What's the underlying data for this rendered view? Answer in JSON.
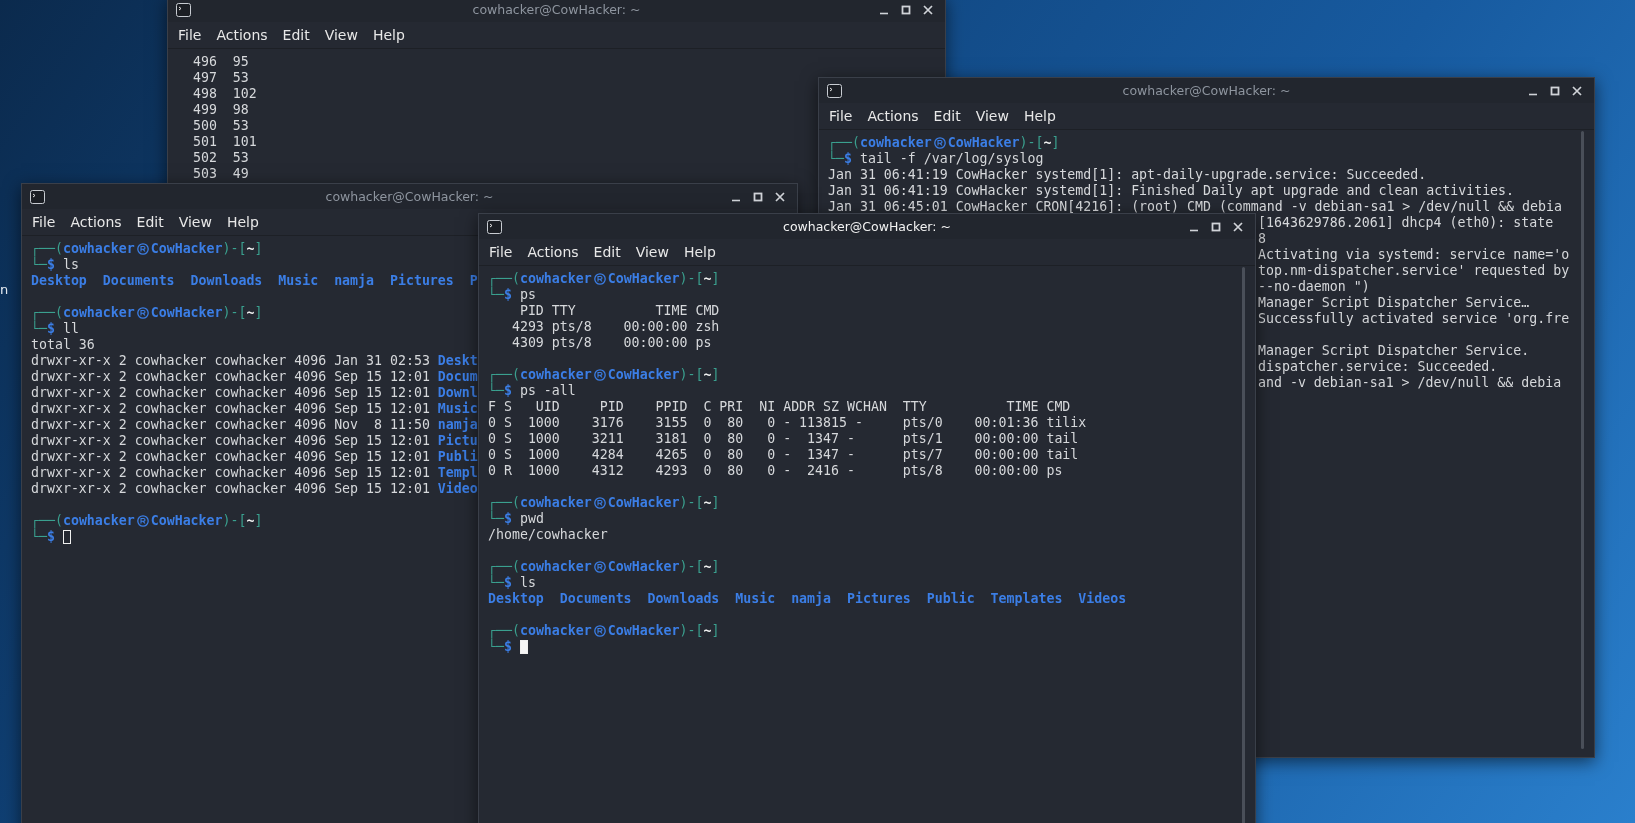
{
  "desktop": {
    "icon_label": "n"
  },
  "windows": [
    {
      "title": "cowhacker@CowHacker: ~",
      "active": false,
      "menu": [
        "File",
        "Actions",
        "Edit",
        "View",
        "Help"
      ],
      "history": [
        {
          "number": "496",
          "value": "95"
        },
        {
          "number": "497",
          "value": "53"
        },
        {
          "number": "498",
          "value": "102"
        },
        {
          "number": "499",
          "value": "98"
        },
        {
          "number": "500",
          "value": "53"
        },
        {
          "number": "501",
          "value": "101"
        },
        {
          "number": "502",
          "value": "53"
        },
        {
          "number": "503",
          "value": "49"
        }
      ]
    },
    {
      "title": "cowhacker@CowHacker: ~",
      "active": false,
      "menu": [
        "File",
        "Actions",
        "Edit",
        "View",
        "Help"
      ],
      "blocks": [
        {
          "prompt_top": [
            "┌──(",
            "cowhacker",
            "CowHacker",
            ")-[",
            "~",
            "]"
          ],
          "prompt_bottom": [
            "└─",
            "$"
          ],
          "command": "tail -f /var/log/syslog",
          "output": [
            {
              "kind": "text",
              "text": "Jan 31 06:41:19 CowHacker systemd[1]: apt-daily-upgrade.service: Succeeded."
            },
            {
              "kind": "text",
              "text": "Jan 31 06:41:19 CowHacker systemd[1]: Finished Daily apt upgrade and clean activities."
            },
            {
              "kind": "text",
              "text": "Jan 31 06:45:01 CowHacker CRON[4216]: (root) CMD (command -v debian-sa1 > /dev/null && debia"
            }
          ]
        }
      ],
      "log_fragments": [
        [
          "[1643629786.2061] dhcp4 (eth0): state",
          "8",
          "Activating via systemd: service name='o",
          "top.nm-dispatcher.service' requested by",
          "--no-daemon \")",
          "Manager Script Dispatcher Service…",
          "Successfully activated service 'org.fre"
        ],
        [
          "Manager Script Dispatcher Service.",
          "dispatcher.service: Succeeded.",
          "and -v debian-sa1 > /dev/null && debia"
        ]
      ]
    },
    {
      "title": "cowhacker@CowHacker: ~",
      "active": false,
      "menu": [
        "File",
        "Actions",
        "Edit",
        "View",
        "Help"
      ],
      "blocks": [
        {
          "prompt_top": [
            "┌──(",
            "cowhacker",
            "CowHacker",
            ")-[",
            "~",
            "]"
          ],
          "prompt_bottom": [
            "└─",
            "$"
          ],
          "command": "ls",
          "output": [
            {
              "kind": "dirs",
              "names": [
                "Desktop",
                "Documents",
                "Downloads",
                "Music",
                "namja",
                "Pictures",
                "P"
              ]
            }
          ]
        },
        {
          "prompt_top": [
            "┌──(",
            "cowhacker",
            "CowHacker",
            ")-[",
            "~",
            "]"
          ],
          "prompt_bottom": [
            "└─",
            "$"
          ],
          "command": "ll",
          "output": [
            {
              "kind": "text",
              "text": "total 36"
            },
            {
              "kind": "entry",
              "text": "drwxr-xr-x 2 cowhacker cowhacker 4096 Jan 31 02:53",
              "name": "Deskt"
            },
            {
              "kind": "entry",
              "text": "drwxr-xr-x 2 cowhacker cowhacker 4096 Sep 15 12:01",
              "name": "Docum"
            },
            {
              "kind": "entry",
              "text": "drwxr-xr-x 2 cowhacker cowhacker 4096 Sep 15 12:01",
              "name": "Downl"
            },
            {
              "kind": "entry",
              "text": "drwxr-xr-x 2 cowhacker cowhacker 4096 Sep 15 12:01",
              "name": "Music"
            },
            {
              "kind": "entry",
              "text": "drwxr-xr-x 2 cowhacker cowhacker 4096 Nov  8 11:50",
              "name": "namja"
            },
            {
              "kind": "entry",
              "text": "drwxr-xr-x 2 cowhacker cowhacker 4096 Sep 15 12:01",
              "name": "Pictu"
            },
            {
              "kind": "entry",
              "text": "drwxr-xr-x 2 cowhacker cowhacker 4096 Sep 15 12:01",
              "name": "Publi"
            },
            {
              "kind": "entry",
              "text": "drwxr-xr-x 2 cowhacker cowhacker 4096 Sep 15 12:01",
              "name": "Templ"
            },
            {
              "kind": "entry",
              "text": "drwxr-xr-x 2 cowhacker cowhacker 4096 Sep 15 12:01",
              "name": "Video"
            }
          ]
        },
        {
          "prompt_top": [
            "┌──(",
            "cowhacker",
            "CowHacker",
            ")-[",
            "~",
            "]"
          ],
          "prompt_bottom": [
            "└─",
            "$"
          ],
          "cursor": true
        }
      ]
    },
    {
      "title": "cowhacker@CowHacker: ~",
      "active": true,
      "menu": [
        "File",
        "Actions",
        "Edit",
        "View",
        "Help"
      ],
      "blocks": [
        {
          "prompt_top": [
            "┌──(",
            "cowhacker",
            "CowHacker",
            ")-[",
            "~",
            "]"
          ],
          "prompt_bottom": [
            "└─",
            "$"
          ],
          "command": "ps",
          "output": [
            {
              "kind": "text",
              "text": "    PID TTY          TIME CMD"
            },
            {
              "kind": "text",
              "text": "   4293 pts/8    00:00:00 zsh"
            },
            {
              "kind": "text",
              "text": "   4309 pts/8    00:00:00 ps"
            }
          ]
        },
        {
          "prompt_top": [
            "┌──(",
            "cowhacker",
            "CowHacker",
            ")-[",
            "~",
            "]"
          ],
          "prompt_bottom": [
            "└─",
            "$"
          ],
          "command": "ps -all",
          "output": [
            {
              "kind": "text",
              "text": "F S   UID     PID    PPID  C PRI  NI ADDR SZ WCHAN  TTY          TIME CMD"
            },
            {
              "kind": "text",
              "text": "0 S  1000    3176    3155  0  80   0 - 113815 -     pts/0    00:01:36 tilix"
            },
            {
              "kind": "text",
              "text": "0 S  1000    3211    3181  0  80   0 -  1347 -      pts/1    00:00:00 tail"
            },
            {
              "kind": "text",
              "text": "0 S  1000    4284    4265  0  80   0 -  1347 -      pts/7    00:00:00 tail"
            },
            {
              "kind": "text",
              "text": "0 R  1000    4312    4293  0  80   0 -  2416 -      pts/8    00:00:00 ps"
            }
          ]
        },
        {
          "prompt_top": [
            "┌──(",
            "cowhacker",
            "CowHacker",
            ")-[",
            "~",
            "]"
          ],
          "prompt_bottom": [
            "└─",
            "$"
          ],
          "command": "pwd",
          "output": [
            {
              "kind": "text",
              "text": "/home/cowhacker"
            }
          ]
        },
        {
          "prompt_top": [
            "┌──(",
            "cowhacker",
            "CowHacker",
            ")-[",
            "~",
            "]"
          ],
          "prompt_bottom": [
            "└─",
            "$"
          ],
          "command": "ls",
          "output": [
            {
              "kind": "dirs",
              "names": [
                "Desktop",
                "Documents",
                "Downloads",
                "Music",
                "namja",
                "Pictures",
                "Public",
                "Templates",
                "Videos"
              ]
            }
          ]
        },
        {
          "prompt_top": [
            "┌──(",
            "cowhacker",
            "CowHacker",
            ")-[",
            "~",
            "]"
          ],
          "prompt_bottom": [
            "└─",
            "$"
          ],
          "cursor": true
        }
      ]
    }
  ]
}
